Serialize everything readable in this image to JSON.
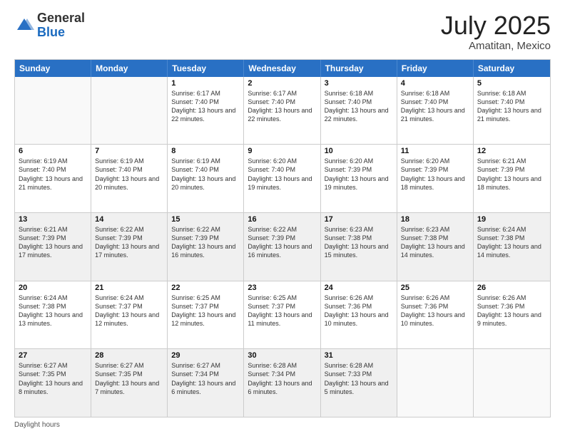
{
  "header": {
    "logo": {
      "general": "General",
      "blue": "Blue"
    },
    "title": "July 2025",
    "location": "Amatitan, Mexico"
  },
  "weekdays": [
    "Sunday",
    "Monday",
    "Tuesday",
    "Wednesday",
    "Thursday",
    "Friday",
    "Saturday"
  ],
  "footer": "Daylight hours",
  "weeks": [
    [
      {
        "day": "",
        "info": "",
        "empty": true
      },
      {
        "day": "",
        "info": "",
        "empty": true
      },
      {
        "day": "1",
        "info": "Sunrise: 6:17 AM\nSunset: 7:40 PM\nDaylight: 13 hours and 22 minutes."
      },
      {
        "day": "2",
        "info": "Sunrise: 6:17 AM\nSunset: 7:40 PM\nDaylight: 13 hours and 22 minutes."
      },
      {
        "day": "3",
        "info": "Sunrise: 6:18 AM\nSunset: 7:40 PM\nDaylight: 13 hours and 22 minutes."
      },
      {
        "day": "4",
        "info": "Sunrise: 6:18 AM\nSunset: 7:40 PM\nDaylight: 13 hours and 21 minutes."
      },
      {
        "day": "5",
        "info": "Sunrise: 6:18 AM\nSunset: 7:40 PM\nDaylight: 13 hours and 21 minutes."
      }
    ],
    [
      {
        "day": "6",
        "info": "Sunrise: 6:19 AM\nSunset: 7:40 PM\nDaylight: 13 hours and 21 minutes."
      },
      {
        "day": "7",
        "info": "Sunrise: 6:19 AM\nSunset: 7:40 PM\nDaylight: 13 hours and 20 minutes."
      },
      {
        "day": "8",
        "info": "Sunrise: 6:19 AM\nSunset: 7:40 PM\nDaylight: 13 hours and 20 minutes."
      },
      {
        "day": "9",
        "info": "Sunrise: 6:20 AM\nSunset: 7:40 PM\nDaylight: 13 hours and 19 minutes."
      },
      {
        "day": "10",
        "info": "Sunrise: 6:20 AM\nSunset: 7:39 PM\nDaylight: 13 hours and 19 minutes."
      },
      {
        "day": "11",
        "info": "Sunrise: 6:20 AM\nSunset: 7:39 PM\nDaylight: 13 hours and 18 minutes."
      },
      {
        "day": "12",
        "info": "Sunrise: 6:21 AM\nSunset: 7:39 PM\nDaylight: 13 hours and 18 minutes."
      }
    ],
    [
      {
        "day": "13",
        "info": "Sunrise: 6:21 AM\nSunset: 7:39 PM\nDaylight: 13 hours and 17 minutes.",
        "shaded": true
      },
      {
        "day": "14",
        "info": "Sunrise: 6:22 AM\nSunset: 7:39 PM\nDaylight: 13 hours and 17 minutes.",
        "shaded": true
      },
      {
        "day": "15",
        "info": "Sunrise: 6:22 AM\nSunset: 7:39 PM\nDaylight: 13 hours and 16 minutes.",
        "shaded": true
      },
      {
        "day": "16",
        "info": "Sunrise: 6:22 AM\nSunset: 7:39 PM\nDaylight: 13 hours and 16 minutes.",
        "shaded": true
      },
      {
        "day": "17",
        "info": "Sunrise: 6:23 AM\nSunset: 7:38 PM\nDaylight: 13 hours and 15 minutes.",
        "shaded": true
      },
      {
        "day": "18",
        "info": "Sunrise: 6:23 AM\nSunset: 7:38 PM\nDaylight: 13 hours and 14 minutes.",
        "shaded": true
      },
      {
        "day": "19",
        "info": "Sunrise: 6:24 AM\nSunset: 7:38 PM\nDaylight: 13 hours and 14 minutes.",
        "shaded": true
      }
    ],
    [
      {
        "day": "20",
        "info": "Sunrise: 6:24 AM\nSunset: 7:38 PM\nDaylight: 13 hours and 13 minutes."
      },
      {
        "day": "21",
        "info": "Sunrise: 6:24 AM\nSunset: 7:37 PM\nDaylight: 13 hours and 12 minutes."
      },
      {
        "day": "22",
        "info": "Sunrise: 6:25 AM\nSunset: 7:37 PM\nDaylight: 13 hours and 12 minutes."
      },
      {
        "day": "23",
        "info": "Sunrise: 6:25 AM\nSunset: 7:37 PM\nDaylight: 13 hours and 11 minutes."
      },
      {
        "day": "24",
        "info": "Sunrise: 6:26 AM\nSunset: 7:36 PM\nDaylight: 13 hours and 10 minutes."
      },
      {
        "day": "25",
        "info": "Sunrise: 6:26 AM\nSunset: 7:36 PM\nDaylight: 13 hours and 10 minutes."
      },
      {
        "day": "26",
        "info": "Sunrise: 6:26 AM\nSunset: 7:36 PM\nDaylight: 13 hours and 9 minutes."
      }
    ],
    [
      {
        "day": "27",
        "info": "Sunrise: 6:27 AM\nSunset: 7:35 PM\nDaylight: 13 hours and 8 minutes.",
        "shaded": true
      },
      {
        "day": "28",
        "info": "Sunrise: 6:27 AM\nSunset: 7:35 PM\nDaylight: 13 hours and 7 minutes.",
        "shaded": true
      },
      {
        "day": "29",
        "info": "Sunrise: 6:27 AM\nSunset: 7:34 PM\nDaylight: 13 hours and 6 minutes.",
        "shaded": true
      },
      {
        "day": "30",
        "info": "Sunrise: 6:28 AM\nSunset: 7:34 PM\nDaylight: 13 hours and 6 minutes.",
        "shaded": true
      },
      {
        "day": "31",
        "info": "Sunrise: 6:28 AM\nSunset: 7:33 PM\nDaylight: 13 hours and 5 minutes.",
        "shaded": true
      },
      {
        "day": "",
        "info": "",
        "empty": true,
        "shaded": false
      },
      {
        "day": "",
        "info": "",
        "empty": true,
        "shaded": false
      }
    ]
  ]
}
